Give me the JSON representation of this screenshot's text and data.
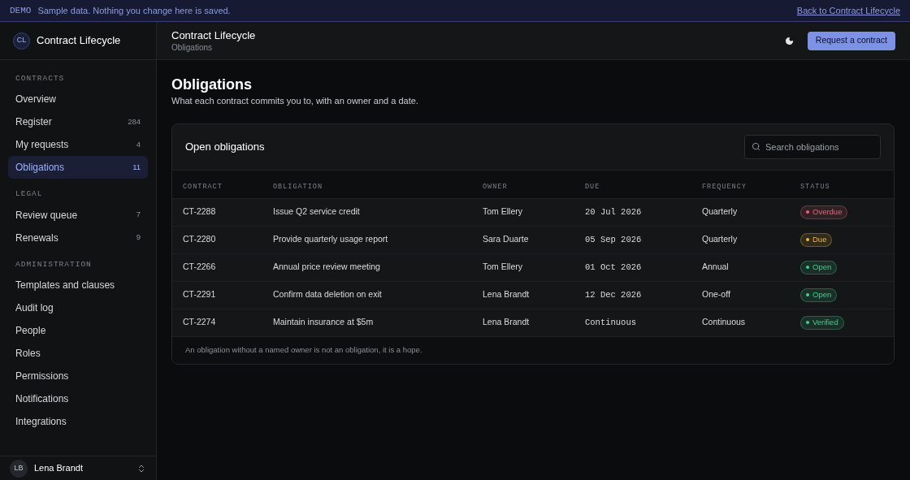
{
  "banner": {
    "tag": "DEMO",
    "message": "Sample data. Nothing you change here is saved.",
    "link": "Back to Contract Lifecycle"
  },
  "app": {
    "initials": "CL",
    "name": "Contract Lifecycle"
  },
  "sidebar": {
    "sections": [
      {
        "heading": "CONTRACTS",
        "items": [
          {
            "label": "Overview",
            "selected": false
          },
          {
            "label": "Register",
            "count": "284",
            "selected": false
          },
          {
            "label": "My requests",
            "count": "4",
            "selected": false
          },
          {
            "label": "Obligations",
            "count": "11",
            "selected": true
          }
        ]
      },
      {
        "heading": "LEGAL",
        "items": [
          {
            "label": "Review queue",
            "count": "7",
            "selected": false
          },
          {
            "label": "Renewals",
            "count": "9",
            "selected": false
          }
        ]
      },
      {
        "heading": "ADMINISTRATION",
        "items": [
          {
            "label": "Templates and clauses",
            "selected": false
          },
          {
            "label": "Audit log",
            "selected": false
          },
          {
            "label": "People",
            "selected": false
          },
          {
            "label": "Roles",
            "selected": false
          },
          {
            "label": "Permissions",
            "selected": false
          },
          {
            "label": "Notifications",
            "selected": false
          },
          {
            "label": "Integrations",
            "selected": false
          }
        ]
      }
    ],
    "user": {
      "initials": "LB",
      "name": "Lena Brandt"
    }
  },
  "header": {
    "title": "Contract Lifecycle",
    "breadcrumb": "Obligations",
    "button": "Request a contract"
  },
  "page": {
    "title": "Obligations",
    "subtitle": "What each contract commits you to, with an owner and a date."
  },
  "card": {
    "title": "Open obligations",
    "search": {
      "placeholder": "Search obligations"
    },
    "table": {
      "columns": [
        "CONTRACT",
        "OBLIGATION",
        "OWNER",
        "DUE",
        "FREQUENCY",
        "STATUS"
      ],
      "rows": [
        {
          "contract": "CT-2288",
          "obligation": "Issue Q2 service credit",
          "owner": "Tom Ellery",
          "due": "20 Jul 2026",
          "frequency": "Quarterly",
          "status": "Overdue",
          "color": "#f0607a"
        },
        {
          "contract": "CT-2280",
          "obligation": "Provide quarterly usage report",
          "owner": "Sara Duarte",
          "due": "05 Sep 2026",
          "frequency": "Quarterly",
          "status": "Due",
          "color": "#f0b43c"
        },
        {
          "contract": "CT-2266",
          "obligation": "Annual price review meeting",
          "owner": "Tom Ellery",
          "due": "01 Oct 2026",
          "frequency": "Annual",
          "status": "Open",
          "color": "#3ecf8e"
        },
        {
          "contract": "CT-2291",
          "obligation": "Confirm data deletion on exit",
          "owner": "Lena Brandt",
          "due": "12 Dec 2026",
          "frequency": "One-off",
          "status": "Open",
          "color": "#3ecf8e"
        },
        {
          "contract": "CT-2274",
          "obligation": "Maintain insurance at $5m",
          "owner": "Lena Brandt",
          "due": "Continuous",
          "frequency": "Continuous",
          "status": "Verified",
          "color": "#3ecf8e"
        }
      ]
    },
    "footnote": "An obligation without a named owner is not an obligation, it is a hope."
  }
}
